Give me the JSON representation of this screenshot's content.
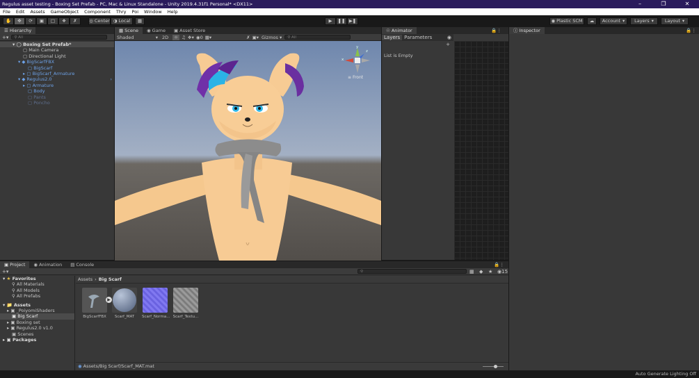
{
  "window": {
    "title": "Regulus asset testing - Boxing Set Prefab - PC, Mac & Linux Standalone - Unity 2019.4.31f1 Personal* <DX11>"
  },
  "menu": [
    "File",
    "Edit",
    "Assets",
    "GameObject",
    "Component",
    "Thry",
    "Poi",
    "Window",
    "Help"
  ],
  "toolbar": {
    "pivot": "Center",
    "space": "Local",
    "plastic": "Plastic SCM",
    "account": "Account",
    "layers": "Layers",
    "layout": "Layout"
  },
  "hierarchy": {
    "tab": "Hierarchy",
    "search_placeholder": "All",
    "root": "Boxing Set Prefab*",
    "items": [
      {
        "label": "Main Camera"
      },
      {
        "label": "Directional Light"
      },
      {
        "label": "BigScarfFBX"
      },
      {
        "label": "BigScarf"
      },
      {
        "label": "BigScarf_Armature"
      },
      {
        "label": "Regulus2.0"
      },
      {
        "label": "Armature"
      },
      {
        "label": "Body"
      },
      {
        "label": "Pants"
      },
      {
        "label": "Poncho"
      }
    ]
  },
  "scene": {
    "tabs": [
      "Scene",
      "Game",
      "Asset Store"
    ],
    "shading": "Shaded",
    "mode2d": "2D",
    "gizmos": "Gizmos",
    "search_placeholder": "All",
    "fx_count": "0",
    "gizmo_label": "Front",
    "axis_y": "y",
    "axis_x": "x",
    "axis_z": "z"
  },
  "animator": {
    "tab": "Animator",
    "subtabs": [
      "Layers",
      "Parameters"
    ],
    "empty": "List is Empty"
  },
  "inspector": {
    "tab": "Inspector"
  },
  "bottom": {
    "tabs": [
      "Project",
      "Animation",
      "Console"
    ],
    "favorites": {
      "label": "Favorites",
      "items": [
        "All Materials",
        "All Models",
        "All Prefabs"
      ]
    },
    "assets": {
      "label": "Assets",
      "items": [
        "_PoiyomiShaders",
        "Big Scarf",
        "Boxing set",
        "Regulus2.0 v1.0",
        "Scenes"
      ]
    },
    "packages": "Packages",
    "breadcrumb": [
      "Assets",
      "Big Scarf"
    ],
    "grid": [
      "BigScarfFBX",
      "Scarf_MAT",
      "Scarf_Norma...",
      "Scarf_Textu..."
    ],
    "footer_path": "Assets/Big Scarf/Scarf_MAT.mat",
    "hidden_count": "15"
  },
  "status": "Auto Generate Lighting Off"
}
